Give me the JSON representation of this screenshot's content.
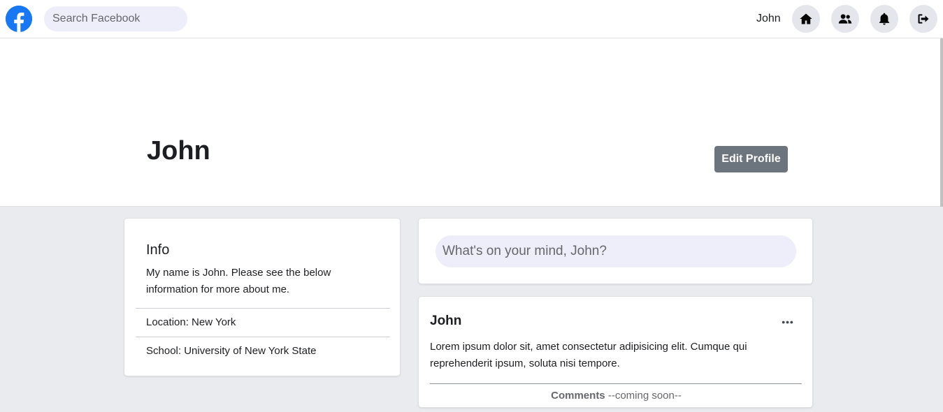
{
  "nav": {
    "search_placeholder": "Search Facebook",
    "username": "John",
    "icons": [
      "facebook-logo",
      "home-icon",
      "friends-icon",
      "bell-icon",
      "logout-icon"
    ]
  },
  "profile": {
    "name": "John",
    "edit_label": "Edit Profile"
  },
  "info": {
    "title": "Info",
    "description": "My name is John. Please see the below information for more about me.",
    "location": "Location: New York",
    "school": "School: University of New York State"
  },
  "composer": {
    "placeholder": "What's on your mind, John?"
  },
  "post": {
    "author": "John",
    "body": "Lorem ipsum dolor sit, amet consectetur adipisicing elit. Cumque qui reprehenderit ipsum, soluta nisi tempore.",
    "comments_label": "Comments",
    "comments_status": "--coming soon--"
  },
  "colors": {
    "brand": "#1877f2",
    "page_bg": "#e9ebee",
    "input_bg": "#eeeefa",
    "button_secondary": "#6c757d"
  }
}
